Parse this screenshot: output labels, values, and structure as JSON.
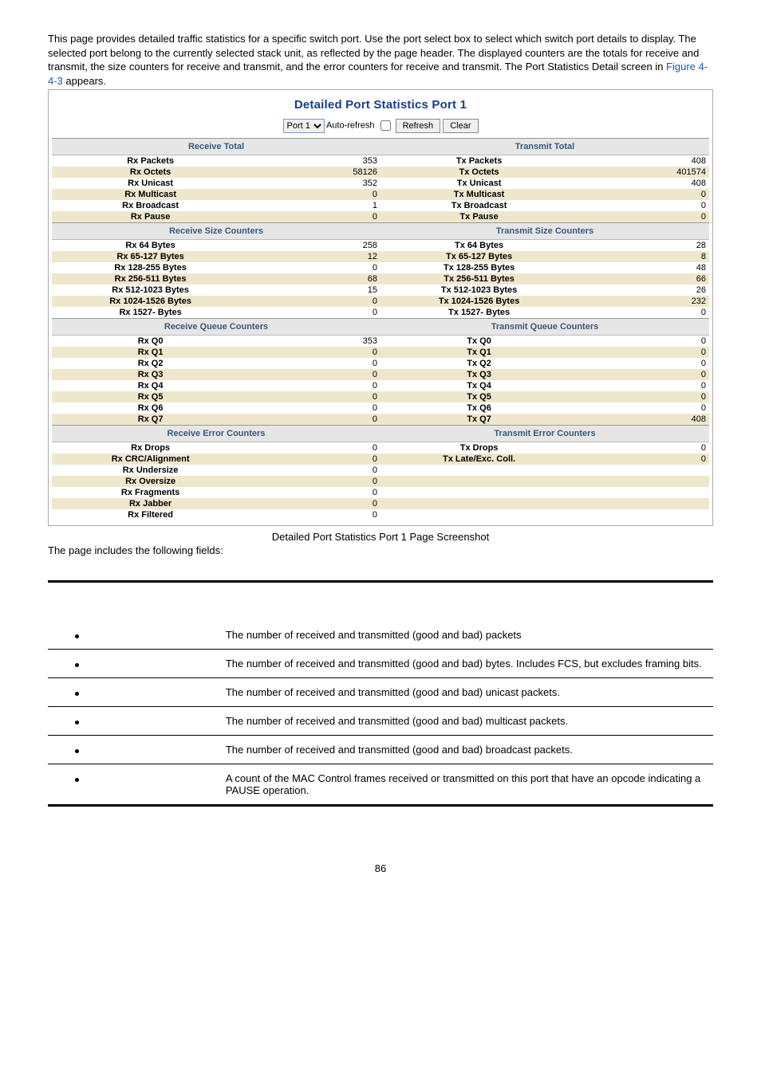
{
  "intro": {
    "text_prefix": "This page provides detailed traffic statistics for a specific switch port. Use the port select box to select which switch port details to display. The selected port belong to the currently selected stack unit, as reflected by the page header. The displayed counters are the totals for receive and transmit, the size counters for receive and transmit, and the error counters for receive and transmit. The Port Statistics Detail screen in ",
    "figref": "Figure 4-4-3",
    "text_suffix": " appears."
  },
  "screenshot": {
    "title": "Detailed Port Statistics  Port 1",
    "toolbar": {
      "port_select": "Port 1",
      "autorefresh_label": "Auto-refresh",
      "refresh_btn": "Refresh",
      "clear_btn": "Clear"
    },
    "sections": [
      {
        "rx_header": "Receive Total",
        "tx_header": "Transmit Total",
        "rows": [
          {
            "alt": false,
            "rx_label": "Rx Packets",
            "rx_val": "353",
            "tx_label": "Tx Packets",
            "tx_val": "408"
          },
          {
            "alt": true,
            "rx_label": "Rx Octets",
            "rx_val": "58126",
            "tx_label": "Tx Octets",
            "tx_val": "401574"
          },
          {
            "alt": false,
            "rx_label": "Rx Unicast",
            "rx_val": "352",
            "tx_label": "Tx Unicast",
            "tx_val": "408"
          },
          {
            "alt": true,
            "rx_label": "Rx Multicast",
            "rx_val": "0",
            "tx_label": "Tx Multicast",
            "tx_val": "0"
          },
          {
            "alt": false,
            "rx_label": "Rx Broadcast",
            "rx_val": "1",
            "tx_label": "Tx Broadcast",
            "tx_val": "0"
          },
          {
            "alt": true,
            "rx_label": "Rx Pause",
            "rx_val": "0",
            "tx_label": "Tx Pause",
            "tx_val": "0"
          }
        ]
      },
      {
        "rx_header": "Receive Size Counters",
        "tx_header": "Transmit Size Counters",
        "rows": [
          {
            "alt": false,
            "rx_label": "Rx 64 Bytes",
            "rx_val": "258",
            "tx_label": "Tx 64 Bytes",
            "tx_val": "28"
          },
          {
            "alt": true,
            "rx_label": "Rx 65-127 Bytes",
            "rx_val": "12",
            "tx_label": "Tx 65-127 Bytes",
            "tx_val": "8"
          },
          {
            "alt": false,
            "rx_label": "Rx 128-255 Bytes",
            "rx_val": "0",
            "tx_label": "Tx 128-255 Bytes",
            "tx_val": "48"
          },
          {
            "alt": true,
            "rx_label": "Rx 256-511 Bytes",
            "rx_val": "68",
            "tx_label": "Tx 256-511 Bytes",
            "tx_val": "66"
          },
          {
            "alt": false,
            "rx_label": "Rx 512-1023 Bytes",
            "rx_val": "15",
            "tx_label": "Tx 512-1023 Bytes",
            "tx_val": "26"
          },
          {
            "alt": true,
            "rx_label": "Rx 1024-1526 Bytes",
            "rx_val": "0",
            "tx_label": "Tx 1024-1526 Bytes",
            "tx_val": "232"
          },
          {
            "alt": false,
            "rx_label": "Rx 1527- Bytes",
            "rx_val": "0",
            "tx_label": "Tx 1527- Bytes",
            "tx_val": "0"
          }
        ]
      },
      {
        "rx_header": "Receive Queue Counters",
        "tx_header": "Transmit Queue Counters",
        "rows": [
          {
            "alt": false,
            "rx_label": "Rx Q0",
            "rx_val": "353",
            "tx_label": "Tx Q0",
            "tx_val": "0"
          },
          {
            "alt": true,
            "rx_label": "Rx Q1",
            "rx_val": "0",
            "tx_label": "Tx Q1",
            "tx_val": "0"
          },
          {
            "alt": false,
            "rx_label": "Rx Q2",
            "rx_val": "0",
            "tx_label": "Tx Q2",
            "tx_val": "0"
          },
          {
            "alt": true,
            "rx_label": "Rx Q3",
            "rx_val": "0",
            "tx_label": "Tx Q3",
            "tx_val": "0"
          },
          {
            "alt": false,
            "rx_label": "Rx Q4",
            "rx_val": "0",
            "tx_label": "Tx Q4",
            "tx_val": "0"
          },
          {
            "alt": true,
            "rx_label": "Rx Q5",
            "rx_val": "0",
            "tx_label": "Tx Q5",
            "tx_val": "0"
          },
          {
            "alt": false,
            "rx_label": "Rx Q6",
            "rx_val": "0",
            "tx_label": "Tx Q6",
            "tx_val": "0"
          },
          {
            "alt": true,
            "rx_label": "Rx Q7",
            "rx_val": "0",
            "tx_label": "Tx Q7",
            "tx_val": "408"
          }
        ]
      },
      {
        "rx_header": "Receive Error Counters",
        "tx_header": "Transmit Error Counters",
        "rows": [
          {
            "alt": false,
            "rx_label": "Rx Drops",
            "rx_val": "0",
            "tx_label": "Tx Drops",
            "tx_val": "0"
          },
          {
            "alt": true,
            "rx_label": "Rx CRC/Alignment",
            "rx_val": "0",
            "tx_label": "Tx Late/Exc. Coll.",
            "tx_val": "0"
          },
          {
            "alt": false,
            "rx_label": "Rx Undersize",
            "rx_val": "0",
            "tx_label": "",
            "tx_val": ""
          },
          {
            "alt": true,
            "rx_label": "Rx Oversize",
            "rx_val": "0",
            "tx_label": "",
            "tx_val": ""
          },
          {
            "alt": false,
            "rx_label": "Rx Fragments",
            "rx_val": "0",
            "tx_label": "",
            "tx_val": ""
          },
          {
            "alt": true,
            "rx_label": "Rx Jabber",
            "rx_val": "0",
            "tx_label": "",
            "tx_val": ""
          },
          {
            "alt": false,
            "rx_label": "Rx Filtered",
            "rx_val": "0",
            "tx_label": "",
            "tx_val": ""
          }
        ]
      }
    ]
  },
  "caption": "Detailed Port Statistics Port 1 Page Screenshot",
  "fields_lead": "The page includes the following fields:",
  "desc_rows": [
    "The number of received and transmitted (good and bad) packets",
    "The number of received and transmitted (good and bad) bytes. Includes FCS, but excludes framing bits.",
    "The number of received and transmitted (good and bad) unicast packets.",
    "The number of received and transmitted (good and bad) multicast packets.",
    "The number of received and transmitted (good and bad) broadcast packets.",
    "A count of the MAC Control frames received or transmitted on this port that have an opcode indicating a PAUSE operation."
  ],
  "pagenum": "86"
}
